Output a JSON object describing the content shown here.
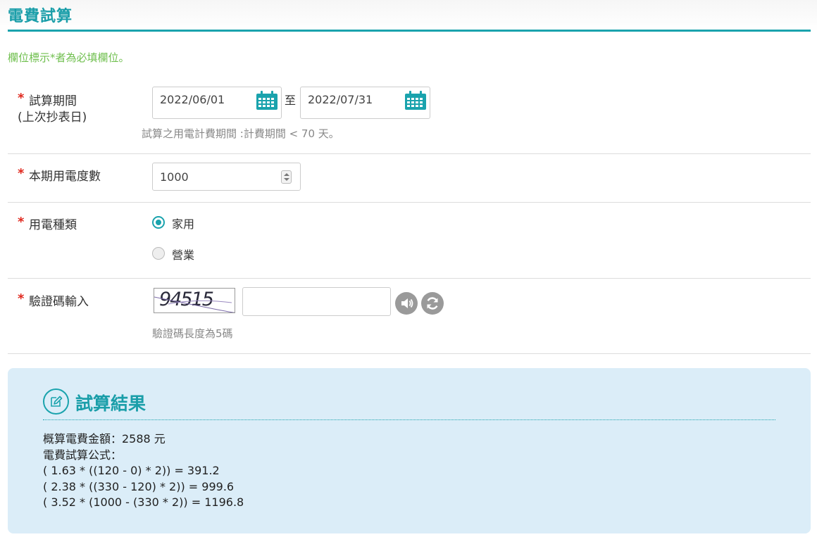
{
  "header": {
    "title": "電費試算"
  },
  "required_note": "欄位標示*者為必填欄位。",
  "form": {
    "period": {
      "star": "*",
      "label_line1": "試算期間",
      "label_line2": "(上次抄表日)",
      "start_date": "2022/06/01",
      "to_label": "至",
      "end_date": "2022/07/31",
      "hint": "試算之用電計費期間 :計費期間 < 70 天。",
      "calendar_icon": "calendar-icon"
    },
    "usage": {
      "star": "*",
      "label": "本期用電度數",
      "value": "1000"
    },
    "type": {
      "star": "*",
      "label": "用電種類",
      "options": [
        {
          "label": "家用",
          "selected": true
        },
        {
          "label": "營業",
          "selected": false
        }
      ]
    },
    "captcha": {
      "star": "*",
      "label": "驗證碼輸入",
      "code": "94515",
      "input_value": "",
      "hint": "驗證碼長度為5碼",
      "audio_icon": "speaker-icon",
      "refresh_icon": "refresh-icon"
    }
  },
  "result": {
    "title": "試算結果",
    "icon": "edit-icon",
    "lines": [
      "概算電費金額：2588 元",
      "電費試算公式：",
      "( 1.63 * ((120 - 0) * 2)) = 391.2",
      "( 2.38 * ((330 - 120) * 2)) = 999.6",
      "( 3.52 * (1000 - (330 * 2)) = 1196.8"
    ]
  },
  "colors": {
    "accent": "#1aa3ad",
    "required_star": "#e0281e",
    "note_green": "#6fbf4e",
    "result_bg": "#dbedf8"
  }
}
